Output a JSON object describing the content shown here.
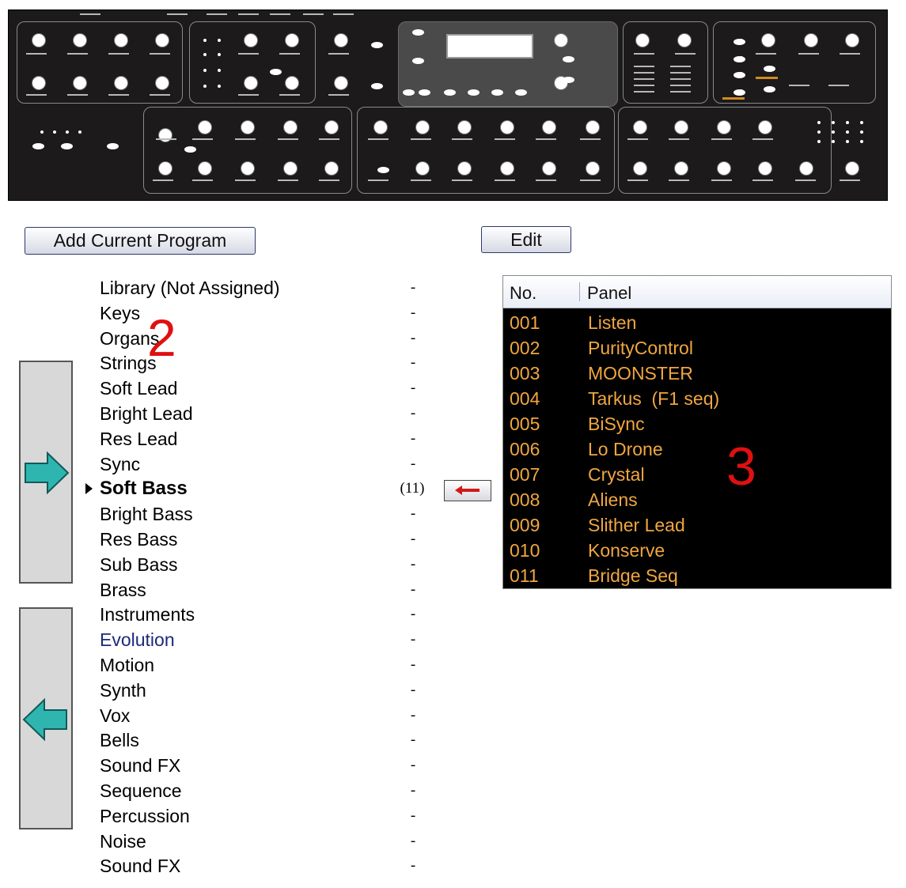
{
  "toolbar": {
    "add_current_program_label": "Add Current Program",
    "edit_label": "Edit"
  },
  "categories": [
    {
      "label": "Library (Not Assigned)",
      "count": "-"
    },
    {
      "label": "Keys",
      "count": "-"
    },
    {
      "label": "Organs",
      "count": "-"
    },
    {
      "label": "Strings",
      "count": "-"
    },
    {
      "label": "Soft Lead",
      "count": "-"
    },
    {
      "label": "Bright Lead",
      "count": "-"
    },
    {
      "label": "Res Lead",
      "count": "-"
    },
    {
      "label": "Sync",
      "count": "-"
    },
    {
      "label": "Soft Bass",
      "count": "(11)",
      "selected": true
    },
    {
      "label": "Bright Bass",
      "count": "-"
    },
    {
      "label": "Res Bass",
      "count": "-"
    },
    {
      "label": "Sub Bass",
      "count": "-"
    },
    {
      "label": "Brass",
      "count": "-"
    },
    {
      "label": "Instruments",
      "count": "-"
    },
    {
      "label": "Evolution",
      "count": "-"
    },
    {
      "label": "Motion",
      "count": "-"
    },
    {
      "label": "Synth",
      "count": "-"
    },
    {
      "label": "Vox",
      "count": "-"
    },
    {
      "label": "Bells",
      "count": "-"
    },
    {
      "label": "Sound FX",
      "count": "-"
    },
    {
      "label": "Sequence",
      "count": "-"
    },
    {
      "label": "Percussion",
      "count": "-"
    },
    {
      "label": "Noise",
      "count": "-"
    },
    {
      "label": "Sound FX",
      "count": "-"
    }
  ],
  "program_table": {
    "columns": [
      "No.",
      "Panel"
    ],
    "rows": [
      {
        "no": "001",
        "panel": "Listen"
      },
      {
        "no": "002",
        "panel": "PurityControl"
      },
      {
        "no": "003",
        "panel": "MOONSTER"
      },
      {
        "no": "004",
        "panel": "Tarkus  (F1 seq)"
      },
      {
        "no": "005",
        "panel": "BiSync"
      },
      {
        "no": "006",
        "panel": "Lo Drone"
      },
      {
        "no": "007",
        "panel": "Crystal"
      },
      {
        "no": "008",
        "panel": "Aliens"
      },
      {
        "no": "009",
        "panel": "Slither Lead"
      },
      {
        "no": "010",
        "panel": "Konserve"
      },
      {
        "no": "011",
        "panel": "Bridge Seq"
      }
    ]
  },
  "annotations": {
    "list_marker": "2",
    "table_marker": "3"
  },
  "icons": {
    "move_right": "teal-arrow-right-icon",
    "move_left": "teal-arrow-left-icon",
    "assign": "red-arrow-left-icon"
  },
  "colors": {
    "panel_bg": "#1c1a1a",
    "table_bg": "#000000",
    "table_text": "#f0a640",
    "arrow_teal": "#2fb5b0",
    "annotation_red": "#e01010",
    "link_text": "#1a2a7a"
  }
}
